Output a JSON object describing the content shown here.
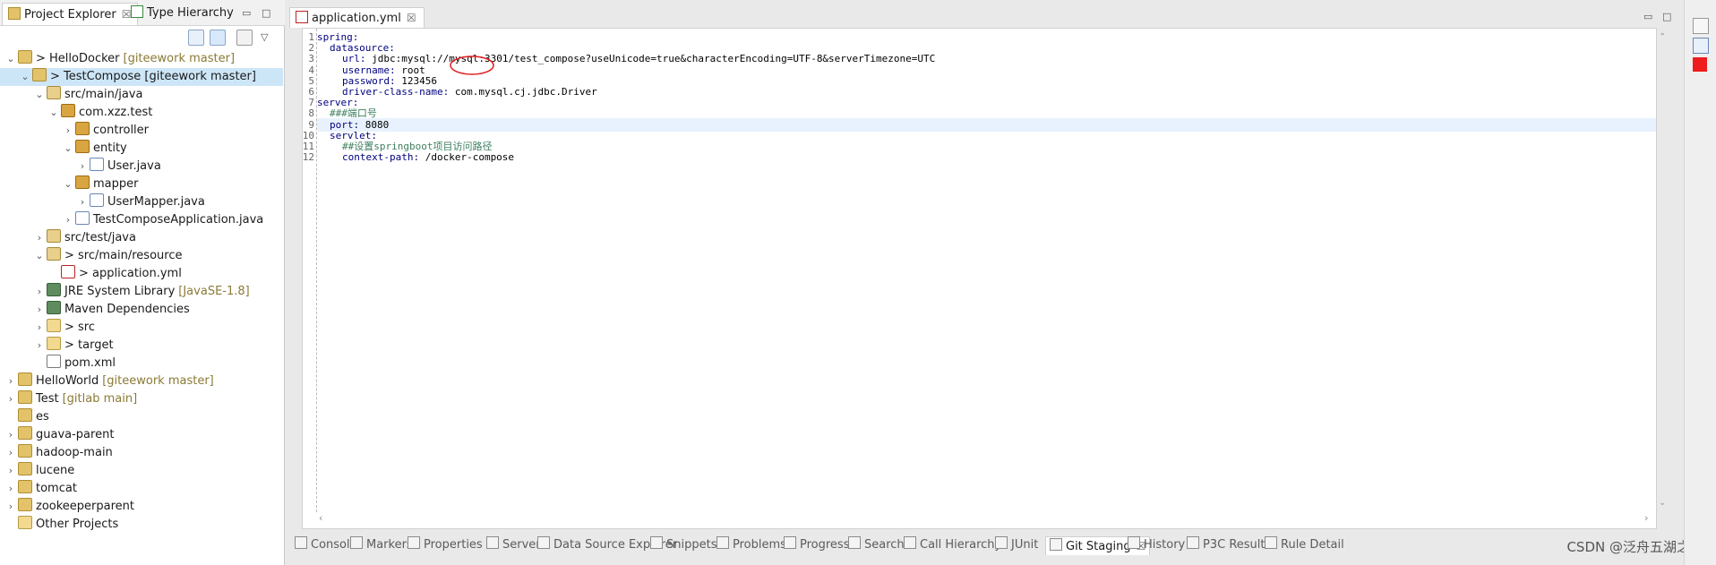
{
  "left_tabs": [
    {
      "label": "Project Explorer",
      "active": true
    },
    {
      "label": "Type Hierarchy",
      "active": false
    }
  ],
  "tree": [
    {
      "label": "> HelloDocker",
      "repo": "[giteework master]",
      "indent": 0,
      "arrow": "v",
      "icon": "proj",
      "selected": false
    },
    {
      "label": "> TestCompose [giteework master]",
      "repo": "",
      "indent": 1,
      "arrow": "v",
      "icon": "proj",
      "selected": true
    },
    {
      "label": "src/main/java",
      "repo": "",
      "indent": 2,
      "arrow": "v",
      "icon": "src",
      "selected": false
    },
    {
      "label": "com.xzz.test",
      "repo": "",
      "indent": 3,
      "arrow": "v",
      "icon": "pkg",
      "selected": false
    },
    {
      "label": "controller",
      "repo": "",
      "indent": 4,
      "arrow": ">",
      "icon": "pkg",
      "selected": false
    },
    {
      "label": "entity",
      "repo": "",
      "indent": 4,
      "arrow": "v",
      "icon": "pkg",
      "selected": false
    },
    {
      "label": "User.java",
      "repo": "",
      "indent": 5,
      "arrow": ">",
      "icon": "java",
      "selected": false
    },
    {
      "label": "mapper",
      "repo": "",
      "indent": 4,
      "arrow": "v",
      "icon": "pkg",
      "selected": false
    },
    {
      "label": "UserMapper.java",
      "repo": "",
      "indent": 5,
      "arrow": ">",
      "icon": "java",
      "selected": false
    },
    {
      "label": "TestComposeApplication.java",
      "repo": "",
      "indent": 4,
      "arrow": ">",
      "icon": "java",
      "selected": false
    },
    {
      "label": "src/test/java",
      "repo": "",
      "indent": 2,
      "arrow": ">",
      "icon": "src",
      "selected": false
    },
    {
      "label": "> src/main/resource",
      "repo": "",
      "indent": 2,
      "arrow": "v",
      "icon": "src",
      "selected": false
    },
    {
      "label": "> application.yml",
      "repo": "",
      "indent": 3,
      "arrow": "",
      "icon": "yml",
      "selected": false
    },
    {
      "label": "JRE System Library",
      "repo": "[JavaSE-1.8]",
      "indent": 2,
      "arrow": ">",
      "icon": "lib",
      "selected": false
    },
    {
      "label": "Maven Dependencies",
      "repo": "",
      "indent": 2,
      "arrow": ">",
      "icon": "lib",
      "selected": false
    },
    {
      "label": "> src",
      "repo": "",
      "indent": 2,
      "arrow": ">",
      "icon": "folder",
      "selected": false
    },
    {
      "label": "> target",
      "repo": "",
      "indent": 2,
      "arrow": ">",
      "icon": "folder",
      "selected": false
    },
    {
      "label": "pom.xml",
      "repo": "",
      "indent": 2,
      "arrow": "",
      "icon": "xml",
      "selected": false
    },
    {
      "label": "HelloWorld",
      "repo": "[giteework master]",
      "indent": 0,
      "arrow": ">",
      "icon": "proj",
      "selected": false
    },
    {
      "label": "Test",
      "repo": "[gitlab main]",
      "indent": 0,
      "arrow": ">",
      "icon": "proj",
      "selected": false
    },
    {
      "label": "es",
      "repo": "",
      "indent": 0,
      "arrow": "",
      "icon": "proj",
      "selected": false
    },
    {
      "label": "guava-parent",
      "repo": "",
      "indent": 0,
      "arrow": ">",
      "icon": "proj",
      "selected": false
    },
    {
      "label": "hadoop-main",
      "repo": "",
      "indent": 0,
      "arrow": ">",
      "icon": "proj",
      "selected": false
    },
    {
      "label": "lucene",
      "repo": "",
      "indent": 0,
      "arrow": ">",
      "icon": "proj",
      "selected": false
    },
    {
      "label": "tomcat",
      "repo": "",
      "indent": 0,
      "arrow": ">",
      "icon": "proj",
      "selected": false
    },
    {
      "label": "zookeeperparent",
      "repo": "",
      "indent": 0,
      "arrow": ">",
      "icon": "proj",
      "selected": false
    },
    {
      "label": "Other Projects",
      "repo": "",
      "indent": 0,
      "arrow": "",
      "icon": "folder",
      "selected": false
    }
  ],
  "editor": {
    "tab_label": "application.yml",
    "lines": [
      {
        "n": "1",
        "key": "spring:",
        "rest": "",
        "indent": 0,
        "comment": false
      },
      {
        "n": "2",
        "key": "datasource:",
        "rest": "",
        "indent": 1,
        "comment": false
      },
      {
        "n": "3",
        "key": "url:",
        "rest": " jdbc:mysql://mysql:3301/test_compose?useUnicode=true&characterEncoding=UTF-8&serverTimezone=UTC",
        "indent": 2,
        "comment": false
      },
      {
        "n": "4",
        "key": "username:",
        "rest": " root",
        "indent": 2,
        "comment": false
      },
      {
        "n": "5",
        "key": "password:",
        "rest": " 123456",
        "indent": 2,
        "comment": false
      },
      {
        "n": "6",
        "key": "driver-class-name:",
        "rest": " com.mysql.cj.jdbc.Driver",
        "indent": 2,
        "comment": false
      },
      {
        "n": "7",
        "key": "server:",
        "rest": "",
        "indent": 0,
        "comment": false
      },
      {
        "n": "8",
        "key": "###端口号",
        "rest": "",
        "indent": 1,
        "comment": true
      },
      {
        "n": "9",
        "key": "port:",
        "rest": " 8080",
        "indent": 1,
        "comment": false
      },
      {
        "n": "10",
        "key": "servlet:",
        "rest": "",
        "indent": 1,
        "comment": false
      },
      {
        "n": "11",
        "key": "##设置springboot项目访问路径",
        "rest": "",
        "indent": 2,
        "comment": true
      },
      {
        "n": "12",
        "key": "context-path:",
        "rest": " /docker-compose",
        "indent": 2,
        "comment": false
      }
    ],
    "current_line": 9
  },
  "bottom_tabs": [
    {
      "label": "Console",
      "active": false
    },
    {
      "label": "Markers",
      "active": false
    },
    {
      "label": "Properties",
      "active": false
    },
    {
      "label": "Servers",
      "active": false
    },
    {
      "label": "Data Source Explorer",
      "active": false
    },
    {
      "label": "Snippets",
      "active": false
    },
    {
      "label": "Problems",
      "active": false
    },
    {
      "label": "Progress",
      "active": false
    },
    {
      "label": "Search",
      "active": false
    },
    {
      "label": "Call Hierarchy",
      "active": false
    },
    {
      "label": "JUnit",
      "active": false
    },
    {
      "label": "Git Staging",
      "active": true
    },
    {
      "label": "History",
      "active": false
    },
    {
      "label": "P3C Results",
      "active": false
    },
    {
      "label": "Rule Detail",
      "active": false
    }
  ],
  "watermark": "CSDN @泛舟五湖之间",
  "colors": {
    "selection": "#cde6f7",
    "keyword": "#000080",
    "comment": "#3f7f5f",
    "current_line": "#e8f2fe",
    "annotation": "#e02020"
  }
}
